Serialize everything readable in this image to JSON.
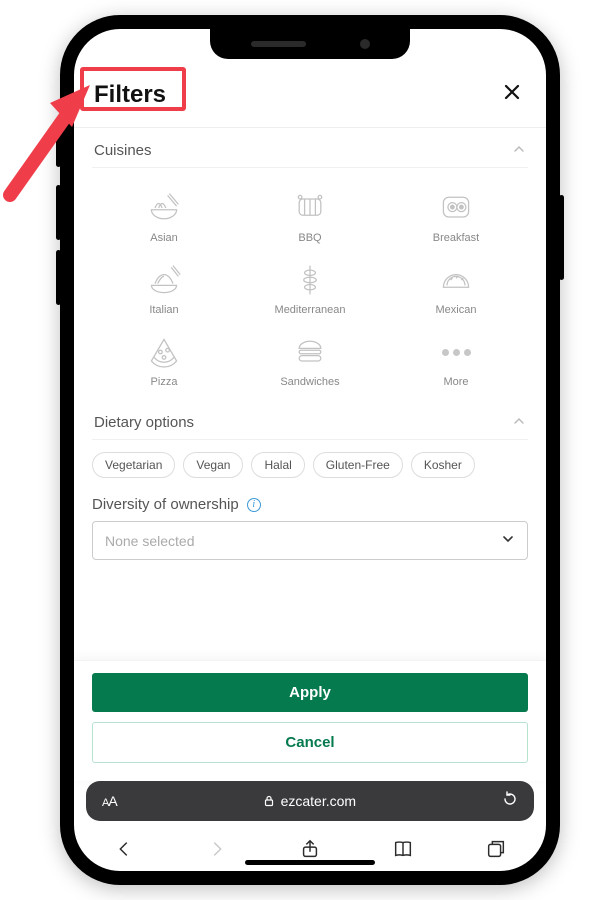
{
  "header": {
    "title": "Filters"
  },
  "sections": {
    "cuisines": {
      "label": "Cuisines",
      "items": [
        {
          "label": "Asian"
        },
        {
          "label": "BBQ"
        },
        {
          "label": "Breakfast"
        },
        {
          "label": "Italian"
        },
        {
          "label": "Mediterranean"
        },
        {
          "label": "Mexican"
        },
        {
          "label": "Pizza"
        },
        {
          "label": "Sandwiches"
        },
        {
          "label": "More"
        }
      ]
    },
    "dietary": {
      "label": "Dietary options",
      "pills": [
        "Vegetarian",
        "Vegan",
        "Halal",
        "Gluten-Free",
        "Kosher"
      ]
    },
    "diversity": {
      "label": "Diversity of ownership",
      "placeholder": "None selected"
    }
  },
  "buttons": {
    "apply": "Apply",
    "cancel": "Cancel"
  },
  "browser": {
    "domain": "ezcater.com"
  },
  "colors": {
    "primary": "#067a4f",
    "highlight": "#ef3e4a"
  }
}
